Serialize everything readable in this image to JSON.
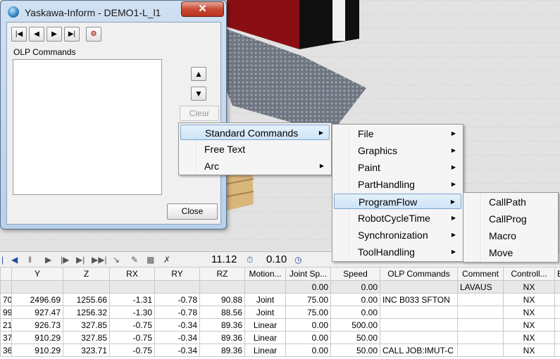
{
  "window": {
    "title": "Yaskawa-Inform - DEMO1-L_l1",
    "close_glyph": "✕",
    "olp_label": "OLP Commands",
    "clear_label": "Clear",
    "close_label": "Close"
  },
  "toolbar": {
    "time_value": "11.12",
    "speed_value": "0.10"
  },
  "menus": {
    "main": [
      "Standard Commands",
      "Free Text",
      "Arc"
    ],
    "standard": [
      "File",
      "Graphics",
      "Paint",
      "PartHandling",
      "ProgramFlow",
      "RobotCycleTime",
      "Synchronization",
      "ToolHandling"
    ],
    "programflow": [
      "CallPath",
      "CallProg",
      "Macro",
      "Move"
    ]
  },
  "grid": {
    "headers": [
      "",
      "Y",
      "Z",
      "RX",
      "RY",
      "RZ",
      "Motion...",
      "Joint Sp...",
      "Speed",
      "OLP Commands",
      "Comment",
      "Controll...",
      "E"
    ],
    "rows": [
      [
        "",
        "",
        "",
        "",
        "",
        "",
        "",
        "0.00",
        "0.00",
        "",
        "LAVAUS",
        "NX",
        ""
      ],
      [
        "70",
        "2496.69",
        "1255.66",
        "-1.31",
        "-0.78",
        "90.88",
        "Joint",
        "75.00",
        "0.00",
        "INC B033  SFTON",
        "",
        "NX",
        ""
      ],
      [
        "99",
        "927.47",
        "1256.32",
        "-1.30",
        "-0.78",
        "88.56",
        "Joint",
        "75.00",
        "0.00",
        "",
        "",
        "NX",
        ""
      ],
      [
        "21",
        "926.73",
        "327.85",
        "-0.75",
        "-0.34",
        "89.36",
        "Linear",
        "0.00",
        "500.00",
        "",
        "",
        "NX",
        ""
      ],
      [
        "37",
        "910.29",
        "327.85",
        "-0.75",
        "-0.34",
        "89.36",
        "Linear",
        "0.00",
        "50.00",
        "",
        "",
        "NX",
        ""
      ],
      [
        "36",
        "910.29",
        "323.71",
        "-0.75",
        "-0.34",
        "89.36",
        "Linear",
        "0.00",
        "50.00",
        "CALL JOB:IMUT-C",
        "",
        "NX",
        ""
      ]
    ]
  }
}
